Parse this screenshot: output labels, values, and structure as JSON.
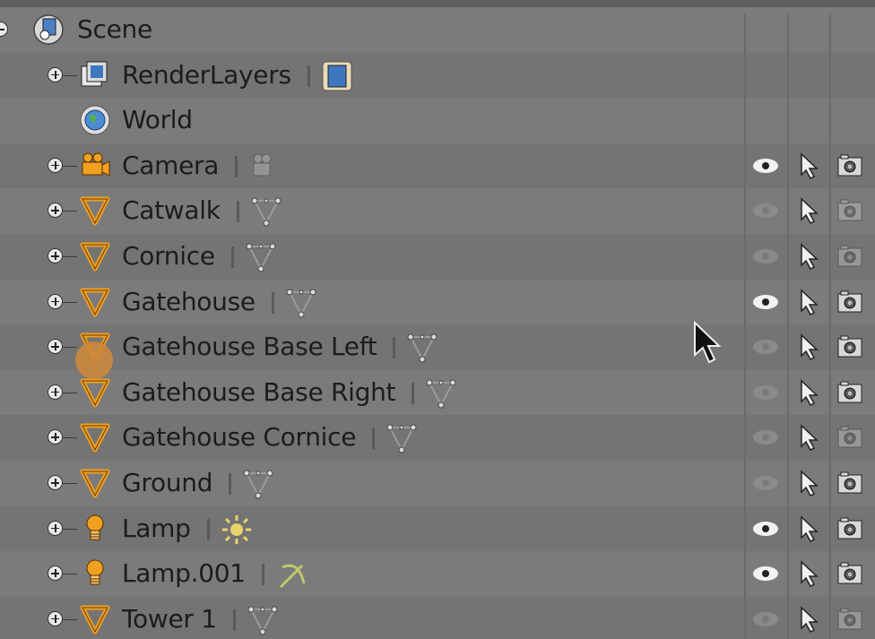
{
  "scene": {
    "label": "Scene"
  },
  "items": [
    {
      "label": "RenderLayers",
      "type": "renderlayers",
      "expander": "plus",
      "eye": null,
      "select": null,
      "render": null
    },
    {
      "label": "World",
      "type": "world",
      "expander": null,
      "eye": null,
      "select": null,
      "render": null
    },
    {
      "label": "Camera",
      "type": "camera",
      "expander": "plus",
      "eye": "visible",
      "select": "on",
      "render": "on"
    },
    {
      "label": "Catwalk",
      "type": "mesh",
      "expander": "plus",
      "eye": "hidden",
      "select": "on",
      "render": "off"
    },
    {
      "label": "Cornice",
      "type": "mesh",
      "expander": "plus",
      "eye": "hidden",
      "select": "on",
      "render": "off"
    },
    {
      "label": "Gatehouse",
      "type": "mesh",
      "expander": "plus",
      "eye": "visible",
      "select": "on",
      "render": "on"
    },
    {
      "label": "Gatehouse Base Left",
      "type": "mesh",
      "expander": "plus",
      "eye": "hidden",
      "select": "on",
      "render": "on"
    },
    {
      "label": "Gatehouse Base Right",
      "type": "mesh",
      "expander": "plus",
      "eye": "hidden",
      "select": "on",
      "render": "on"
    },
    {
      "label": "Gatehouse Cornice",
      "type": "mesh",
      "expander": "plus",
      "eye": "hidden",
      "select": "on",
      "render": "off"
    },
    {
      "label": "Ground",
      "type": "mesh",
      "expander": "plus",
      "eye": "hidden",
      "select": "on",
      "render": "on"
    },
    {
      "label": "Lamp",
      "type": "lamp-sun",
      "expander": "plus",
      "eye": "visible",
      "select": "on",
      "render": "on"
    },
    {
      "label": "Lamp.001",
      "type": "lamp-spot",
      "expander": "plus",
      "eye": "visible",
      "select": "on",
      "render": "on"
    },
    {
      "label": "Tower 1",
      "type": "mesh",
      "expander": "plus",
      "eye": "hidden",
      "select": "on",
      "render": "off"
    }
  ],
  "colors": {
    "object_orange": "#f0a020",
    "eye_active": "#f2f2f2",
    "eye_inactive": "#8a8a8a"
  }
}
